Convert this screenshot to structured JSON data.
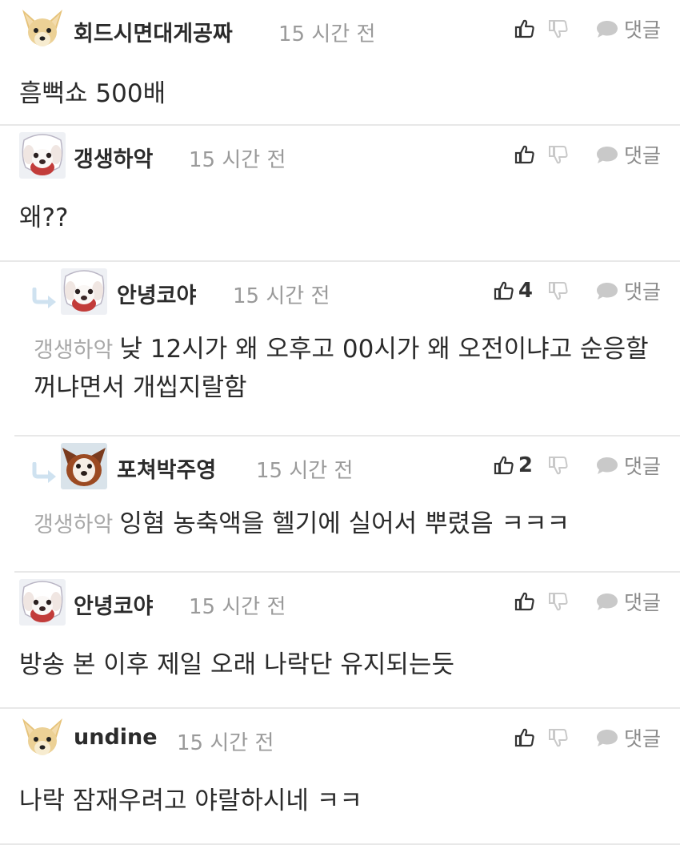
{
  "ui": {
    "reply_label": "댓글",
    "icons": {
      "like": "thumbs-up-icon",
      "dislike": "thumbs-down-icon",
      "reply": "speech-bubble-icon",
      "reply_arrow": "reply-arrow-icon"
    },
    "colors": {
      "text": "#2a2a2a",
      "time": "#9a9a9a",
      "mention": "#a8a8a8",
      "reply_arrow": "#cfe2f0",
      "divider": "#e8e8e8"
    }
  },
  "comments": [
    {
      "author": "회드시면대게공짜",
      "time": "15 시간 전",
      "text": "흠뻑쇼 500배",
      "likes": "",
      "avatar": "chihuahua"
    },
    {
      "author": "갱생하악",
      "time": "15 시간 전",
      "text": "왜??",
      "likes": "",
      "avatar": "dog-white"
    },
    {
      "author": "안녕코야",
      "time": "15 시간 전",
      "mention": "갱생하악",
      "text": "낮 12시가 왜 오후고 00시가 왜 오전이냐고 순응할꺼냐면서 개씹지랄함",
      "likes": "4",
      "avatar": "dog-white"
    },
    {
      "author": "포쳐박주영",
      "time": "15 시간 전",
      "mention": "갱생하악",
      "text": "잉혐 농축액을 헬기에 실어서 뿌렸음 ㅋㅋㅋ",
      "likes": "2",
      "avatar": "dog-brown"
    },
    {
      "author": "안녕코야",
      "time": "15 시간 전",
      "text": "방송 본 이후 제일 오래 나락단 유지되는듯",
      "likes": "",
      "avatar": "dog-white"
    },
    {
      "author": "undine",
      "time": "15 시간 전",
      "text": "나락 잠재우려고 야랄하시네 ㅋㅋ",
      "likes": "",
      "avatar": "chihuahua"
    }
  ]
}
